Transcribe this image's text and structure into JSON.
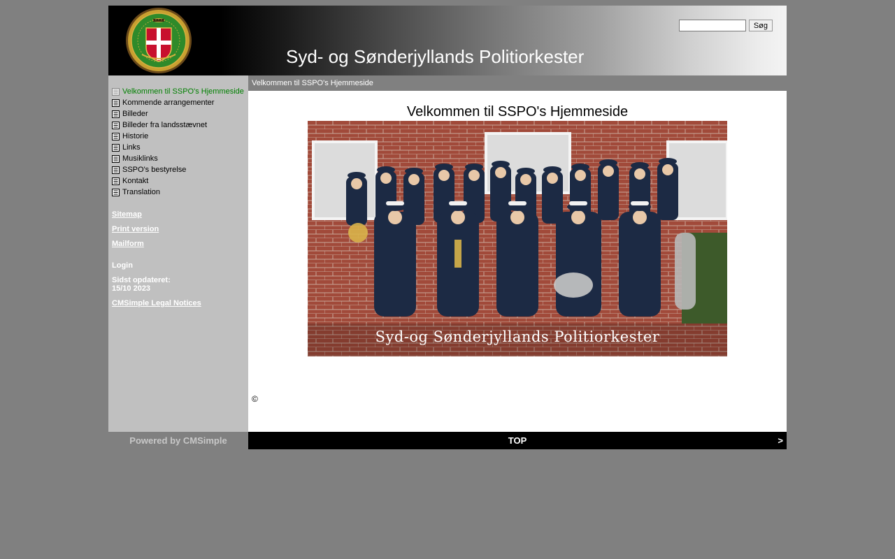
{
  "header": {
    "site_title": "Syd- og Sønderjyllands Politiorkester",
    "search_button": "Søg",
    "search_value": ""
  },
  "sidebar": {
    "nav": [
      {
        "label": "Velkommen til SSPO's Hjemmeside",
        "active": true
      },
      {
        "label": "Kommende arrangementer"
      },
      {
        "label": "Billeder"
      },
      {
        "label": "Billeder fra landsstævnet"
      },
      {
        "label": "Historie"
      },
      {
        "label": "Links"
      },
      {
        "label": "Musiklinks"
      },
      {
        "label": "SSPO's bestyrelse"
      },
      {
        "label": "Kontakt"
      },
      {
        "label": "Translation"
      }
    ],
    "sitemap": "Sitemap",
    "print": "Print version",
    "mailform": "Mailform",
    "login": "Login",
    "updated_label": "Sidst opdateret:",
    "updated_date": "15/10 2023",
    "legal": "CMSimple Legal Notices"
  },
  "content": {
    "breadcrumb": "Velkommen til SSPO's Hjemmeside",
    "heading": "Velkommen til SSPO's Hjemmeside",
    "photo_caption": "Syd-og Sønderjyllands Politiorkester",
    "copyright": "©"
  },
  "footer": {
    "powered": "Powered by CMSimple",
    "top": "TOP",
    "next": ">"
  },
  "colors": {
    "active_nav": "#008000",
    "sidebar_bg": "#c0c0c0",
    "page_bg": "#808080"
  }
}
